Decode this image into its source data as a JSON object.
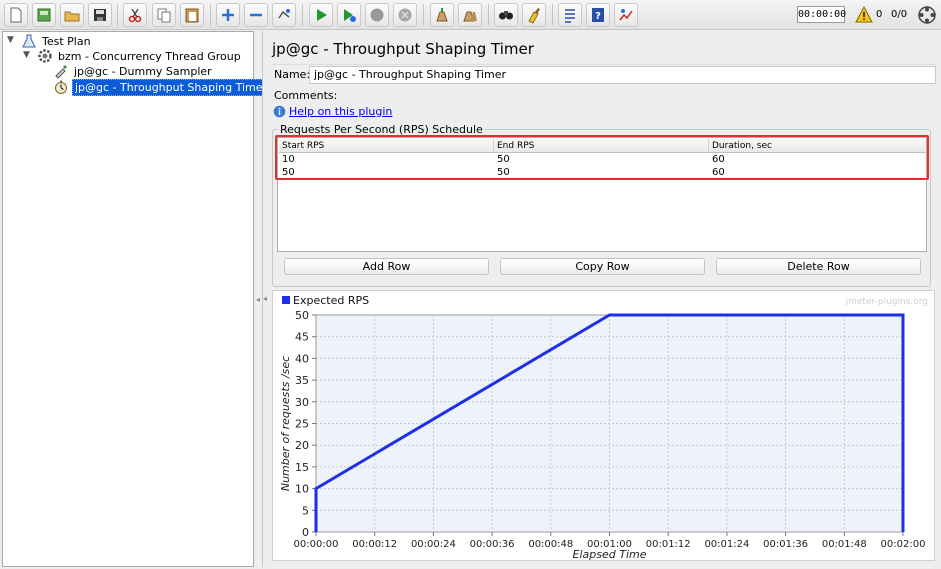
{
  "toolbar": {
    "icons": [
      "new-icon",
      "templates-icon",
      "open-icon",
      "save-icon",
      "cut-icon",
      "copy-icon",
      "paste-icon",
      "expand-icon",
      "collapse-icon",
      "toggle-icon",
      "start-icon",
      "start-no-pause-icon",
      "stop-icon",
      "shutdown-icon",
      "clear-icon",
      "clear-all-icon",
      "search-icon",
      "reset-search-icon",
      "function-helper-icon",
      "help-icon",
      "log-icon"
    ],
    "timer": "00:00:00",
    "warning_count": "0",
    "threads": "0/0"
  },
  "tree": {
    "nodes": [
      {
        "label": "Test Plan",
        "icon": "flask-icon"
      },
      {
        "label": "bzm - Concurrency Thread Group",
        "icon": "gear-icon"
      },
      {
        "label": "jp@gc - Dummy Sampler",
        "icon": "pipette-icon"
      },
      {
        "label": "jp@gc - Throughput Shaping Timer",
        "icon": "stopwatch-icon"
      }
    ]
  },
  "panel": {
    "title": "jp@gc - Throughput Shaping Timer",
    "name_label": "Name:",
    "name_value": "jp@gc - Throughput Shaping Timer",
    "comments_label": "Comments:",
    "help_link": "Help on this plugin"
  },
  "schedule": {
    "legend": "Requests Per Second (RPS) Schedule",
    "columns": [
      "Start RPS",
      "End RPS",
      "Duration, sec"
    ],
    "rows": [
      [
        "10",
        "50",
        "60"
      ],
      [
        "50",
        "50",
        "60"
      ]
    ],
    "buttons": [
      "Add Row",
      "Copy Row",
      "Delete Row"
    ]
  },
  "chart_data": {
    "type": "line",
    "watermark": "jmeter-plugins.org",
    "series": [
      {
        "name": "Expected RPS",
        "color": "#1f2fe8",
        "points": [
          [
            "00:00:00",
            0
          ],
          [
            "00:00:00",
            10
          ],
          [
            "00:01:00",
            50
          ],
          [
            "00:02:00",
            50
          ],
          [
            "00:02:00",
            0
          ]
        ]
      }
    ],
    "xlabel": "Elapsed Time",
    "ylabel": "Number of requests /sec",
    "x_ticks": [
      "00:00:00",
      "00:00:12",
      "00:00:24",
      "00:00:36",
      "00:00:48",
      "00:01:00",
      "00:01:12",
      "00:01:24",
      "00:01:36",
      "00:01:48",
      "00:02:00"
    ],
    "y_ticks": [
      "0",
      "5",
      "10",
      "15",
      "20",
      "25",
      "30",
      "35",
      "40",
      "45",
      "50"
    ],
    "ylim": [
      0,
      50
    ],
    "xlim_seconds": [
      0,
      120
    ],
    "grid": true,
    "legend_position": "top-left"
  },
  "colors": {
    "selection": "#0b5dd7",
    "highlight": "#e0312b",
    "series": "#1f2fe8",
    "plot_bg": "#eef2fa"
  }
}
